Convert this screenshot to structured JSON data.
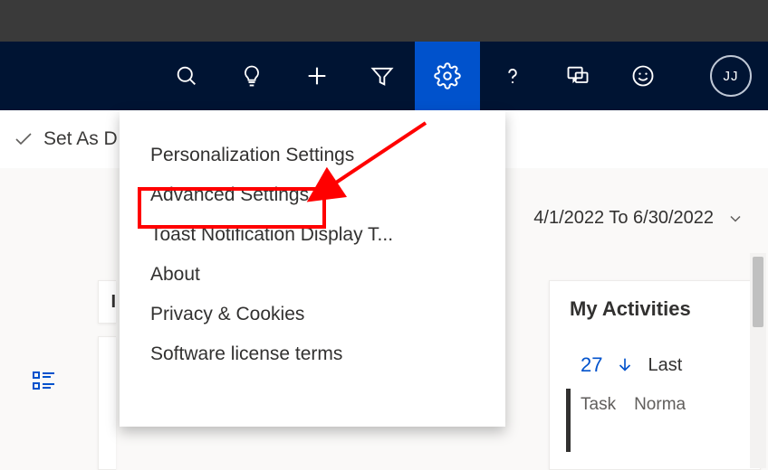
{
  "toolbar": {
    "set_as_default": "Set As D"
  },
  "settings_menu": {
    "items": [
      {
        "label": "Personalization Settings"
      },
      {
        "label": "Advanced Settings"
      },
      {
        "label": "Toast Notification Display T..."
      },
      {
        "label": "About"
      },
      {
        "label": "Privacy & Cookies"
      },
      {
        "label": "Software license terms"
      }
    ]
  },
  "date_range": {
    "text": "4/1/2022 To 6/30/2022"
  },
  "my_activities": {
    "title": "My Activities",
    "count": "27",
    "last": "Last",
    "col1": "Task",
    "col2": "Norma"
  },
  "avatar": {
    "initials": "JJ"
  },
  "colors": {
    "nav_bg": "#001433",
    "accent": "#0052cc",
    "annotation": "#ff0000"
  }
}
